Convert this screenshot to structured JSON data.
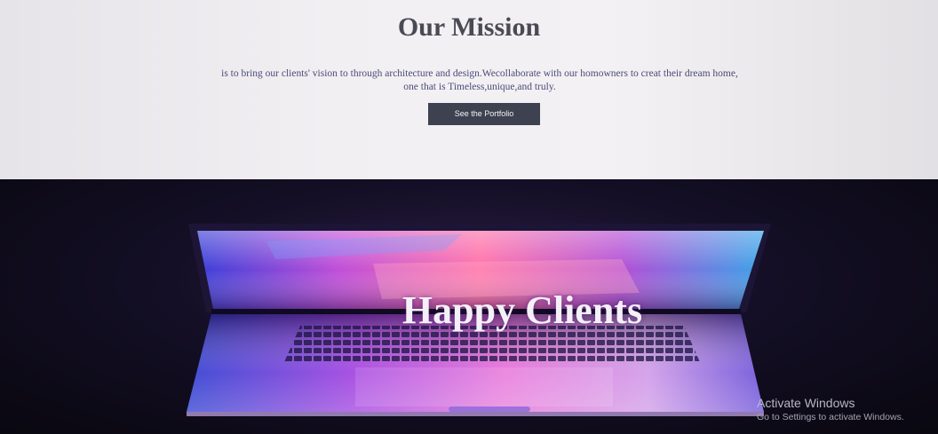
{
  "mission": {
    "title": "Our Mission",
    "text": "is to bring our clients' vision to through architecture and design.Wecollaborate with our homowners to creat their dream home, one that is Timeless,unique,and truly.",
    "button_label": "See the Portfolio"
  },
  "clients": {
    "title": "Happy Clients"
  },
  "watermark": {
    "title": "Activate Windows",
    "subtitle": "Go to Settings to activate Windows."
  },
  "colors": {
    "mission_bg": "#f1eff2",
    "button_bg": "#3e4150",
    "hero_bg": "#140f26"
  }
}
